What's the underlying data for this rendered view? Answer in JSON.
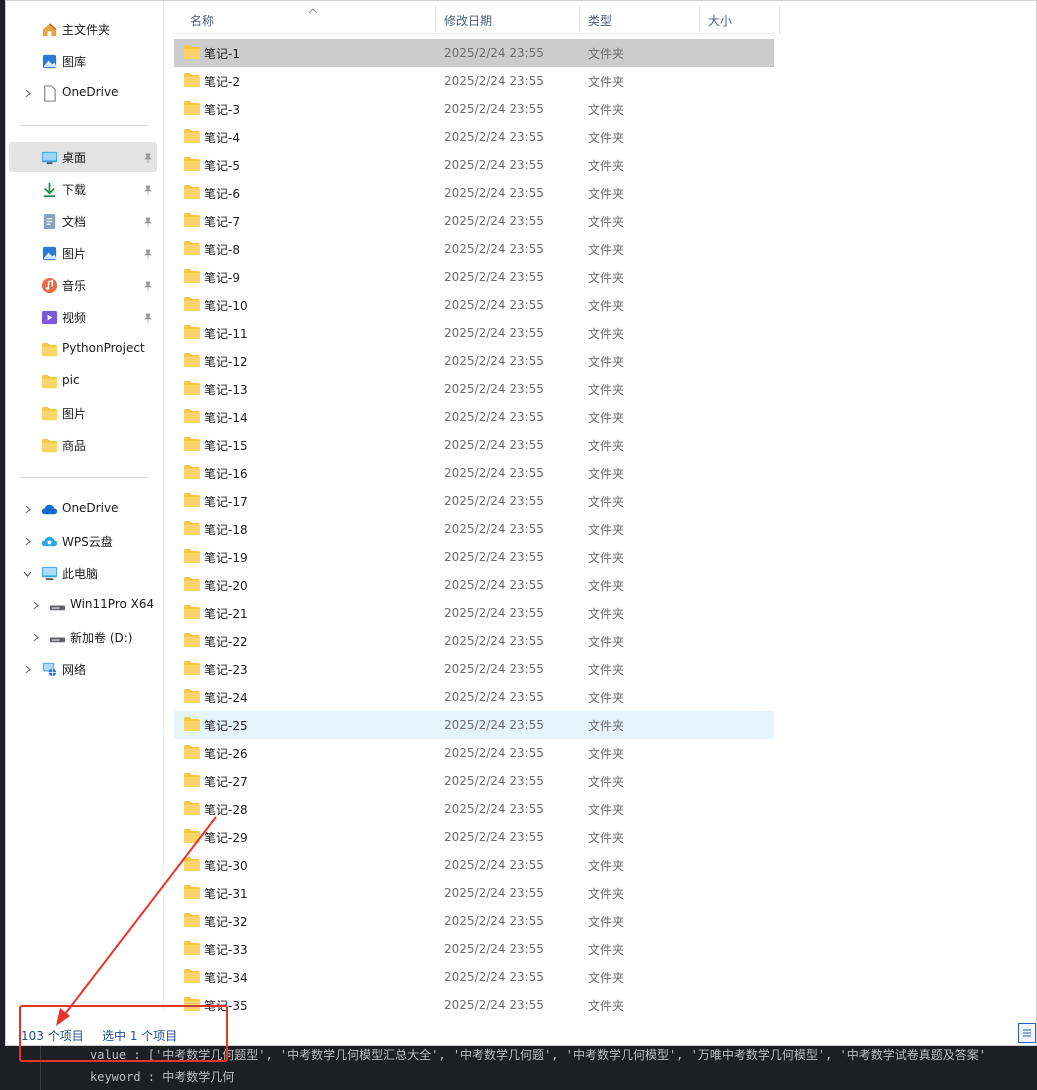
{
  "sidebar": {
    "quick": [
      {
        "label": "主文件夹",
        "icon": "home-icon"
      },
      {
        "label": "图库",
        "icon": "gallery-icon"
      },
      {
        "label": "OneDrive",
        "icon": "document-icon"
      }
    ],
    "pinned": [
      {
        "label": "桌面",
        "icon": "desktop-icon",
        "pinned": true,
        "active": true
      },
      {
        "label": "下载",
        "icon": "download-icon",
        "pinned": true
      },
      {
        "label": "文档",
        "icon": "documents-icon",
        "pinned": true
      },
      {
        "label": "图片",
        "icon": "pictures-icon",
        "pinned": true
      },
      {
        "label": "音乐",
        "icon": "music-icon",
        "pinned": true
      },
      {
        "label": "视频",
        "icon": "videos-icon",
        "pinned": true
      },
      {
        "label": "PythonProject",
        "icon": "folder-icon"
      },
      {
        "label": "pic",
        "icon": "folder-icon"
      },
      {
        "label": "图片",
        "icon": "folder-icon"
      },
      {
        "label": "商品",
        "icon": "folder-icon"
      }
    ],
    "tree": [
      {
        "label": "OneDrive",
        "icon": "cloud-icon"
      },
      {
        "label": "WPS云盘",
        "icon": "wps-cloud-icon"
      },
      {
        "label": "此电脑",
        "icon": "computer-icon"
      },
      {
        "label": "Win11Pro X64",
        "icon": "drive-icon"
      },
      {
        "label": "新加卷 (D:)",
        "icon": "drive-icon"
      },
      {
        "label": "网络",
        "icon": "network-icon"
      }
    ]
  },
  "columns": {
    "name": "名称",
    "date": "修改日期",
    "type": "类型",
    "size": "大小"
  },
  "files": [
    {
      "name": "笔记-1",
      "date": "2025/2/24 23:55",
      "type": "文件夹"
    },
    {
      "name": "笔记-2",
      "date": "2025/2/24 23:55",
      "type": "文件夹"
    },
    {
      "name": "笔记-3",
      "date": "2025/2/24 23:55",
      "type": "文件夹"
    },
    {
      "name": "笔记-4",
      "date": "2025/2/24 23:55",
      "type": "文件夹"
    },
    {
      "name": "笔记-5",
      "date": "2025/2/24 23:55",
      "type": "文件夹"
    },
    {
      "name": "笔记-6",
      "date": "2025/2/24 23:55",
      "type": "文件夹"
    },
    {
      "name": "笔记-7",
      "date": "2025/2/24 23:55",
      "type": "文件夹"
    },
    {
      "name": "笔记-8",
      "date": "2025/2/24 23:55",
      "type": "文件夹"
    },
    {
      "name": "笔记-9",
      "date": "2025/2/24 23:55",
      "type": "文件夹"
    },
    {
      "name": "笔记-10",
      "date": "2025/2/24 23:55",
      "type": "文件夹"
    },
    {
      "name": "笔记-11",
      "date": "2025/2/24 23:55",
      "type": "文件夹"
    },
    {
      "name": "笔记-12",
      "date": "2025/2/24 23:55",
      "type": "文件夹"
    },
    {
      "name": "笔记-13",
      "date": "2025/2/24 23:55",
      "type": "文件夹"
    },
    {
      "name": "笔记-14",
      "date": "2025/2/24 23:55",
      "type": "文件夹"
    },
    {
      "name": "笔记-15",
      "date": "2025/2/24 23:55",
      "type": "文件夹"
    },
    {
      "name": "笔记-16",
      "date": "2025/2/24 23:55",
      "type": "文件夹"
    },
    {
      "name": "笔记-17",
      "date": "2025/2/24 23:55",
      "type": "文件夹"
    },
    {
      "name": "笔记-18",
      "date": "2025/2/24 23:55",
      "type": "文件夹"
    },
    {
      "name": "笔记-19",
      "date": "2025/2/24 23:55",
      "type": "文件夹"
    },
    {
      "name": "笔记-20",
      "date": "2025/2/24 23:55",
      "type": "文件夹"
    },
    {
      "name": "笔记-21",
      "date": "2025/2/24 23:55",
      "type": "文件夹"
    },
    {
      "name": "笔记-22",
      "date": "2025/2/24 23:55",
      "type": "文件夹"
    },
    {
      "name": "笔记-23",
      "date": "2025/2/24 23:55",
      "type": "文件夹"
    },
    {
      "name": "笔记-24",
      "date": "2025/2/24 23:55",
      "type": "文件夹"
    },
    {
      "name": "笔记-25",
      "date": "2025/2/24 23:55",
      "type": "文件夹"
    },
    {
      "name": "笔记-26",
      "date": "2025/2/24 23:55",
      "type": "文件夹"
    },
    {
      "name": "笔记-27",
      "date": "2025/2/24 23:55",
      "type": "文件夹"
    },
    {
      "name": "笔记-28",
      "date": "2025/2/24 23:55",
      "type": "文件夹"
    },
    {
      "name": "笔记-29",
      "date": "2025/2/24 23:55",
      "type": "文件夹"
    },
    {
      "name": "笔记-30",
      "date": "2025/2/24 23:55",
      "type": "文件夹"
    },
    {
      "name": "笔记-31",
      "date": "2025/2/24 23:55",
      "type": "文件夹"
    },
    {
      "name": "笔记-32",
      "date": "2025/2/24 23:55",
      "type": "文件夹"
    },
    {
      "name": "笔记-33",
      "date": "2025/2/24 23:55",
      "type": "文件夹"
    },
    {
      "name": "笔记-34",
      "date": "2025/2/24 23:55",
      "type": "文件夹"
    },
    {
      "name": "笔记-35",
      "date": "2025/2/24 23:55",
      "type": "文件夹"
    }
  ],
  "selected_file": "笔记-1",
  "hovered_file": "笔记-25",
  "status": {
    "count": "103 个项目",
    "selection": "选中 1 个项目"
  },
  "console": {
    "line1": "value : ['中考数学几何题型', '中考数学几何模型汇总大全', '中考数学几何题', '中考数学几何模型', '万唯中考数学几何模型', '中考数学试卷真题及答案'",
    "line2": "keyword : 中考数学几何"
  },
  "colors": {
    "selected_row": "#cccccc",
    "hover_row": "#e5f3fb",
    "annotation": "#e5352b",
    "folder": "#f8c74a"
  }
}
